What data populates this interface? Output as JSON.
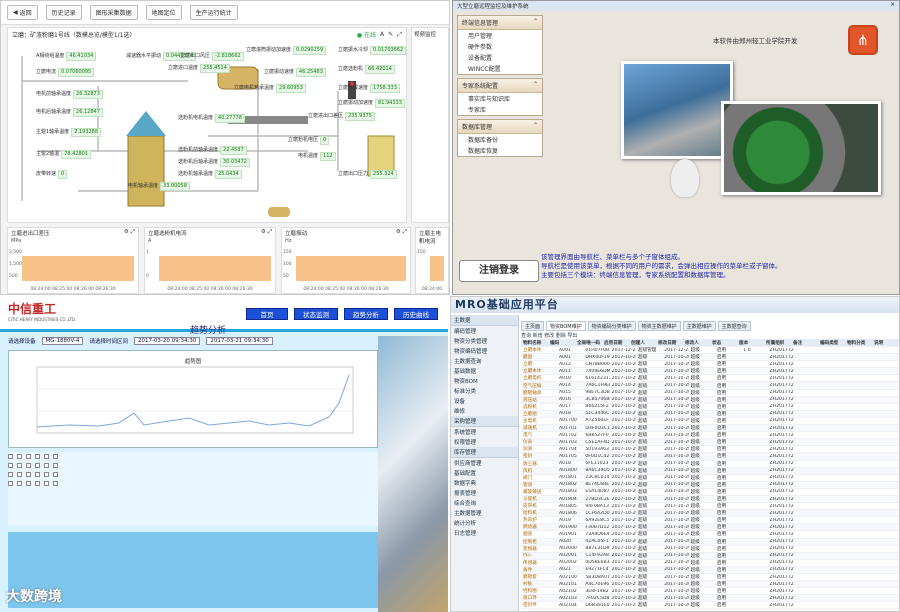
{
  "q1": {
    "toolbar": {
      "back": "返回",
      "items": [
        "历史记录",
        "图形采集数据",
        "地图定位",
        "生产运行统计"
      ]
    },
    "panel_title": "立磨：矿渣粉磨1号线（数模总览/模型1/1选）",
    "online": "在线",
    "tags": [
      {
        "label": "A相绕组温度",
        "value": "46.41034"
      },
      {
        "label": "减速器水平振动",
        "value": "0.0449574"
      },
      {
        "label": "立磨出口风压",
        "value": "-2.818662"
      },
      {
        "label": "立磨滚筒振动加速度",
        "value": "0.0290259"
      },
      {
        "label": "立磨振水冷却",
        "value": "0.01703662"
      },
      {
        "label": "立磨电流",
        "value": "0.07060095"
      },
      {
        "label": "立磨进口温度",
        "value": "255.4514"
      },
      {
        "label": "立磨振动速度",
        "value": "46.25483"
      },
      {
        "label": "立磨选粉机",
        "value": "66.42014"
      },
      {
        "label": "电机前轴承温度",
        "value": "26.32873"
      },
      {
        "label": "立磨增减速度",
        "value": "1758.333"
      },
      {
        "label": "电机后轴承温度",
        "value": "26.12847"
      },
      {
        "label": "立磨电机轴承温度",
        "value": "29.60953"
      },
      {
        "label": "立磨振动加速度",
        "value": "81.94333"
      },
      {
        "label": "主辊1轴承温度",
        "value": "2.193288"
      },
      {
        "label": "选粉机电机温度",
        "value": "40.27778"
      },
      {
        "label": "立磨进出口差压",
        "value": "235.9375"
      },
      {
        "label": "主辊2轴温",
        "value": "78.42801"
      },
      {
        "label": "选粉机前轴承温度",
        "value": "22.4537"
      },
      {
        "label": "立磨粉机电压",
        "value": "0"
      },
      {
        "label": "选粉机后轴承温度",
        "value": "30.03472"
      },
      {
        "label": "电机温度",
        "value": "112"
      },
      {
        "label": "选粉机轴承温度",
        "value": "25.0434"
      },
      {
        "label": "立磨出口压力",
        "value": "255.324"
      },
      {
        "label": "电机轴承温度",
        "value": "33.00058"
      },
      {
        "label": "皮带转速",
        "value": "0"
      }
    ],
    "side_title": "视频监控",
    "charts": [
      {
        "title": "立磨进出口差压",
        "unit": "MPa",
        "ticks": [
          "2,500",
          "2,000",
          "1,500",
          "1,000",
          "500",
          "0"
        ],
        "times": "08:24:00  08:25:00  08:26:00  08:26:30"
      },
      {
        "title": "立磨选粉机电流",
        "unit": "A",
        "ticks": [
          "1",
          "0.5",
          "0"
        ],
        "times": "08:24:00  08:25:00  08:26:00  08:26:30"
      },
      {
        "title": "立磨振动",
        "unit": "Hz",
        "ticks": [
          "150",
          "100",
          "50"
        ],
        "times": "08:24:00  08:25:00  08:26:00  08:26:30"
      },
      {
        "title": "立磨主电机电流",
        "unit": "A",
        "ticks": [
          "150",
          "100"
        ],
        "times": "08:24:00"
      }
    ]
  },
  "q2": {
    "window_title": "大型立磨远程监控及维护系统",
    "menu": [
      {
        "title": "终端信息管理",
        "items": [
          "用户管理",
          "硬件参数",
          "设备配置",
          "WINCC配置"
        ]
      },
      {
        "title": "专家系统配置",
        "items": [
          "事实库与知识库",
          "专家库"
        ]
      },
      {
        "title": "数据库管理",
        "items": [
          "数据库备份",
          "数据库恢复"
        ]
      }
    ],
    "developer": "本软件由郑州轻工业学院开发",
    "info": [
      "该管理界面由导航栏、菜单栏与多个子窗体组成。",
      "导航栏是使用该菜单，根据不同的用户的需求，会弹出相应操作的菜单栏或子窗体。",
      "主要包括三个模块：终端信息管理，专家系统配置和数据库管理。"
    ],
    "logout": "注销登录"
  },
  "q3": {
    "company": "中信重工",
    "company_en": "CITIC HEAVY INDUSTRIES CO.,LTD.",
    "nav": [
      "首页",
      "状态监测",
      "趋势分析",
      "历史曲线"
    ],
    "title": "趋势分析",
    "filter": {
      "l1": "请选择设备",
      "v1": "MG-1880V-4",
      "l2": "请选择时间区间",
      "v2": "2017-03-20 09:34:30",
      "v3": "2017-03-21 09:34:30"
    },
    "chart_title": "趋势图",
    "brand": "大数跨境"
  },
  "q4": {
    "title": "MRO基础应用平台",
    "sidebar": [
      "主数据",
      "编码管理",
      "物资分类管理",
      "物资编码管理",
      "主数据查询",
      "基础数据",
      "物资BOM",
      "标准分类",
      "设备",
      "维修",
      "采购管理",
      "系统管理",
      "权限管理",
      "库存管理",
      "供应商管理",
      "基础配置",
      "数据字典",
      "报表管理",
      "综合查询",
      "主数据管理",
      "统计分析",
      "日志管理"
    ],
    "tabs": [
      "主页面",
      "物资BOM维护",
      "物资编码分类维护",
      "物资主数据维护",
      "主数据维护",
      "主数据查询"
    ],
    "toolbar": "查询  新增  修改  删除  导出",
    "headers": [
      "物料名称",
      "编码",
      "全局唯一码",
      "启用日期",
      "创建人",
      "修改日期",
      "修改人",
      "状态",
      "版本",
      "所属组织",
      "备注",
      "编码类型",
      "物料分类",
      "说明"
    ],
    "rows": [
      [
        "立磨本体",
        "A001",
        "01H07F0B146",
        "2017-12-23",
        "超级管理",
        "2017-12-23",
        "超级",
        "启用",
        "1.0",
        "ZH2017726",
        "",
        "",
        "",
        ""
      ],
      [
        "磨盘",
        "A001",
        "DHK00F1971",
        "2017-10-29",
        "超级",
        "2017-10-29",
        "超级",
        "启用",
        "",
        "ZH2017726",
        "",
        "",
        "",
        ""
      ],
      [
        "立磨",
        "A012",
        "CN78B0001",
        "2017-10-29",
        "超级",
        "2017-10-29",
        "超级",
        "启用",
        "",
        "ZH2017726",
        "",
        "",
        "",
        ""
      ],
      [
        "立磨本体",
        "A011",
        "7X00E6DMFB",
        "2017-10-29",
        "超级",
        "2017-10-29",
        "超级",
        "启用",
        "",
        "ZH2017726",
        "",
        "",
        "",
        ""
      ],
      [
        "立磨电机",
        "A010",
        "6161423114",
        "2017-10-29",
        "超级",
        "2017-10-29",
        "超级",
        "启用",
        "",
        "ZH2017726",
        "",
        "",
        "",
        ""
      ],
      [
        "空气压缩",
        "A014",
        "7A6C1F9EE",
        "2017-10-29",
        "超级",
        "2017-10-29",
        "超级",
        "启用",
        "",
        "ZH2017726",
        "",
        "",
        "",
        ""
      ],
      [
        "磨辊轴承",
        "A015",
        "98E7C3DB",
        "2017-10-29",
        "超级",
        "2017-10-29",
        "超级",
        "启用",
        "",
        "ZH2017726",
        "",
        "",
        "",
        ""
      ],
      [
        "液压站",
        "A016",
        "3CB5706BC",
        "2017-10-29",
        "超级",
        "2017-10-29",
        "超级",
        "启用",
        "",
        "ZH2017726",
        "",
        "",
        "",
        ""
      ],
      [
        "选粉机",
        "A017",
        "B66215F2",
        "2017-10-29",
        "超级",
        "2017-10-29",
        "超级",
        "启用",
        "",
        "ZH2017726",
        "",
        "",
        "",
        ""
      ],
      [
        "立磨组",
        "A018",
        "51C3446C",
        "2017-10-29",
        "超级",
        "2017-10-29",
        "超级",
        "启用",
        "",
        "ZH2017726",
        "",
        "",
        "",
        ""
      ],
      [
        "主电机",
        "A01700",
        "A7Z560EF",
        "2017-10-29",
        "超级",
        "2017-10-29",
        "超级",
        "启用",
        "",
        "ZH2017726",
        "",
        "",
        "",
        ""
      ],
      [
        "减速机",
        "A01701",
        "D3F0D3C1",
        "2017-10-29",
        "超级",
        "2017-10-29",
        "超级",
        "启用",
        "",
        "ZH2017726",
        "",
        "",
        "",
        ""
      ],
      [
        "电气",
        "A01702",
        "6B8527F0",
        "2017-10-29",
        "超级",
        "2017-10-29",
        "超级",
        "启用",
        "",
        "ZH2017726",
        "",
        "",
        "",
        ""
      ],
      [
        "仪表",
        "A01703",
        "C5E1AF4D",
        "2017-10-29",
        "超级",
        "2017-10-29",
        "超级",
        "启用",
        "",
        "ZH2017726",
        "",
        "",
        "",
        ""
      ],
      [
        "润滑",
        "A01704",
        "50193A63",
        "2017-10-29",
        "超级",
        "2017-10-29",
        "超级",
        "启用",
        "",
        "ZH2017726",
        "",
        "",
        "",
        ""
      ],
      [
        "密封",
        "A01705",
        "0F0D1C42",
        "2017-10-29",
        "超级",
        "2017-10-29",
        "超级",
        "启用",
        "",
        "ZH2017726",
        "",
        "",
        "",
        ""
      ],
      [
        "收尘器",
        "A018",
        "6FE11023",
        "2017-10-29",
        "超级",
        "2017-10-29",
        "超级",
        "启用",
        "",
        "ZH2017726",
        "",
        "",
        "",
        ""
      ],
      [
        "风机",
        "A01800",
        "8A6C39D5",
        "2017-10-29",
        "超级",
        "2017-10-29",
        "超级",
        "启用",
        "",
        "ZH2017726",
        "",
        "",
        "",
        ""
      ],
      [
        "阀门",
        "A01801",
        "23CBC014",
        "2017-10-29",
        "超级",
        "2017-10-29",
        "超级",
        "启用",
        "",
        "ZH2017726",
        "",
        "",
        "",
        ""
      ],
      [
        "管道",
        "A01802",
        "8E74C6BE",
        "2017-10-29",
        "超级",
        "2017-10-29",
        "超级",
        "启用",
        "",
        "ZH2017726",
        "",
        "",
        "",
        ""
      ],
      [
        "螺旋输送",
        "A01803",
        "E5A14D87",
        "2017-10-29",
        "超级",
        "2017-10-29",
        "超级",
        "启用",
        "",
        "ZH2017726",
        "",
        "",
        "",
        ""
      ],
      [
        "斗提机",
        "A01804",
        "27BD3C2E",
        "2017-10-29",
        "超级",
        "2017-10-29",
        "超级",
        "启用",
        "",
        "ZH2017726",
        "",
        "",
        "",
        ""
      ],
      [
        "皮带机",
        "A01805",
        "94F0BA13",
        "2017-10-29",
        "超级",
        "2017-10-29",
        "超级",
        "启用",
        "",
        "ZH2017726",
        "",
        "",
        "",
        ""
      ],
      [
        "给料机",
        "A01806",
        "1CF6A2D0",
        "2017-10-29",
        "超级",
        "2017-10-29",
        "超级",
        "启用",
        "",
        "ZH2017726",
        "",
        "",
        "",
        ""
      ],
      [
        "热风炉",
        "A019",
        "6A92E8C5",
        "2017-10-29",
        "超级",
        "2017-10-29",
        "超级",
        "启用",
        "",
        "ZH2017726",
        "",
        "",
        "",
        ""
      ],
      [
        "燃烧器",
        "A01900",
        "F30B7D12",
        "2017-10-29",
        "超级",
        "2017-10-29",
        "超级",
        "启用",
        "",
        "ZH2017726",
        "",
        "",
        "",
        ""
      ],
      [
        "烟道",
        "A01901",
        "73A9D6E4",
        "2017-10-29",
        "超级",
        "2017-10-29",
        "超级",
        "启用",
        "",
        "ZH2017726",
        "",
        "",
        "",
        ""
      ],
      [
        "控制柜",
        "A020",
        "42AC05F1",
        "2017-10-29",
        "超级",
        "2017-10-29",
        "超级",
        "启用",
        "",
        "ZH2017726",
        "",
        "",
        "",
        ""
      ],
      [
        "变频器",
        "A02000",
        "B87E31D9",
        "2017-10-29",
        "超级",
        "2017-10-29",
        "超级",
        "启用",
        "",
        "ZH2017726",
        "",
        "",
        "",
        ""
      ],
      [
        "PLC",
        "A02001",
        "C14F92A8",
        "2017-10-29",
        "超级",
        "2017-10-29",
        "超级",
        "启用",
        "",
        "ZH2017726",
        "",
        "",
        "",
        ""
      ],
      [
        "传感器",
        "A02002",
        "0D58E6B3",
        "2017-10-29",
        "超级",
        "2017-10-29",
        "超级",
        "启用",
        "",
        "ZH2017726",
        "",
        "",
        "",
        ""
      ],
      [
        "备件",
        "A021",
        "E9271FC4",
        "2017-10-29",
        "超级",
        "2017-10-29",
        "超级",
        "启用",
        "",
        "ZH2017726",
        "",
        "",
        "",
        ""
      ],
      [
        "磨辊套",
        "A02100",
        "5B3D8A07",
        "2017-10-29",
        "超级",
        "2017-10-29",
        "超级",
        "启用",
        "",
        "ZH2017726",
        "",
        "",
        "",
        ""
      ],
      [
        "衬板",
        "A02101",
        "A4C70E96",
        "2017-10-29",
        "超级",
        "2017-10-29",
        "超级",
        "启用",
        "",
        "ZH2017726",
        "",
        "",
        "",
        ""
      ],
      [
        "挡料圈",
        "A02102",
        "3E8F14B2",
        "2017-10-29",
        "超级",
        "2017-10-29",
        "超级",
        "启用",
        "",
        "ZH2017726",
        "",
        "",
        "",
        ""
      ],
      [
        "喷口环",
        "A02103",
        "7F02C5D8",
        "2017-10-29",
        "超级",
        "2017-10-29",
        "超级",
        "启用",
        "",
        "ZH2017726",
        "",
        "",
        "",
        ""
      ],
      [
        "密封件",
        "A02104",
        "D6B391E0",
        "2017-10-29",
        "超级",
        "2017-10-29",
        "超级",
        "启用",
        "",
        "ZH2017726",
        "",
        "",
        "",
        ""
      ]
    ]
  },
  "colors": {
    "online": "#2ba84a",
    "chart_fill": "#f7c38a",
    "q3_nav": "#1e4fd7",
    "q3_accent": "#25a7dd",
    "q4_title": "#1d3b63",
    "info_text": "#1c25b0"
  }
}
